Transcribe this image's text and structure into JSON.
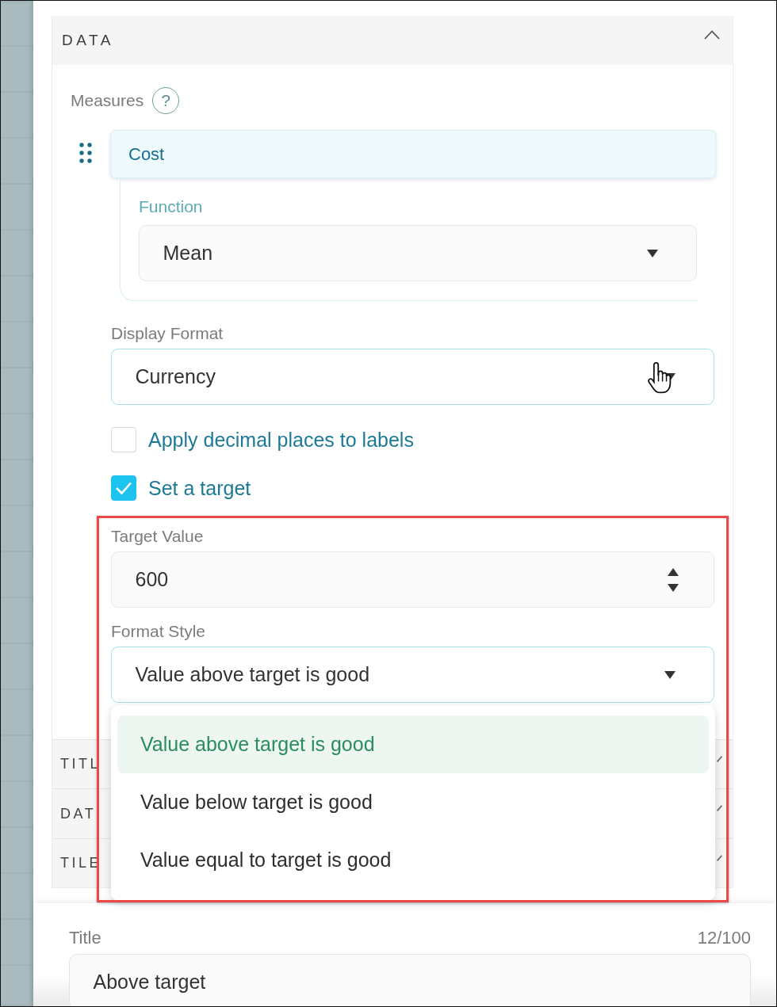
{
  "panel": {
    "title": "DATA",
    "expanded": true,
    "measures": {
      "label": "Measures",
      "help": "?",
      "items": [
        {
          "name": "Cost",
          "expanded": true,
          "function": {
            "label": "Function",
            "value": "Mean",
            "focused": false
          }
        }
      ]
    },
    "display_format": {
      "label": "Display Format",
      "value": "Currency",
      "focused": true,
      "hovered": true
    },
    "options": [
      {
        "label": "Apply decimal places to labels",
        "checked": false
      },
      {
        "label": "Set a target",
        "checked": true
      }
    ],
    "target_value": {
      "label": "Target Value",
      "value": "600",
      "focused": false
    },
    "format_style": {
      "label": "Format Style",
      "value": "Value above target is good",
      "focused": true,
      "open": true,
      "options": [
        {
          "label": "Value above target is good",
          "selected": true
        },
        {
          "label": "Value below target is good",
          "selected": false
        },
        {
          "label": "Value equal to target is good",
          "selected": false
        }
      ]
    }
  },
  "sections": [
    {
      "title": "TITL"
    },
    {
      "title": "DAT"
    },
    {
      "title": "TILE"
    }
  ],
  "title_field": {
    "label": "Title",
    "counter": "12/100",
    "value": "Above target"
  }
}
